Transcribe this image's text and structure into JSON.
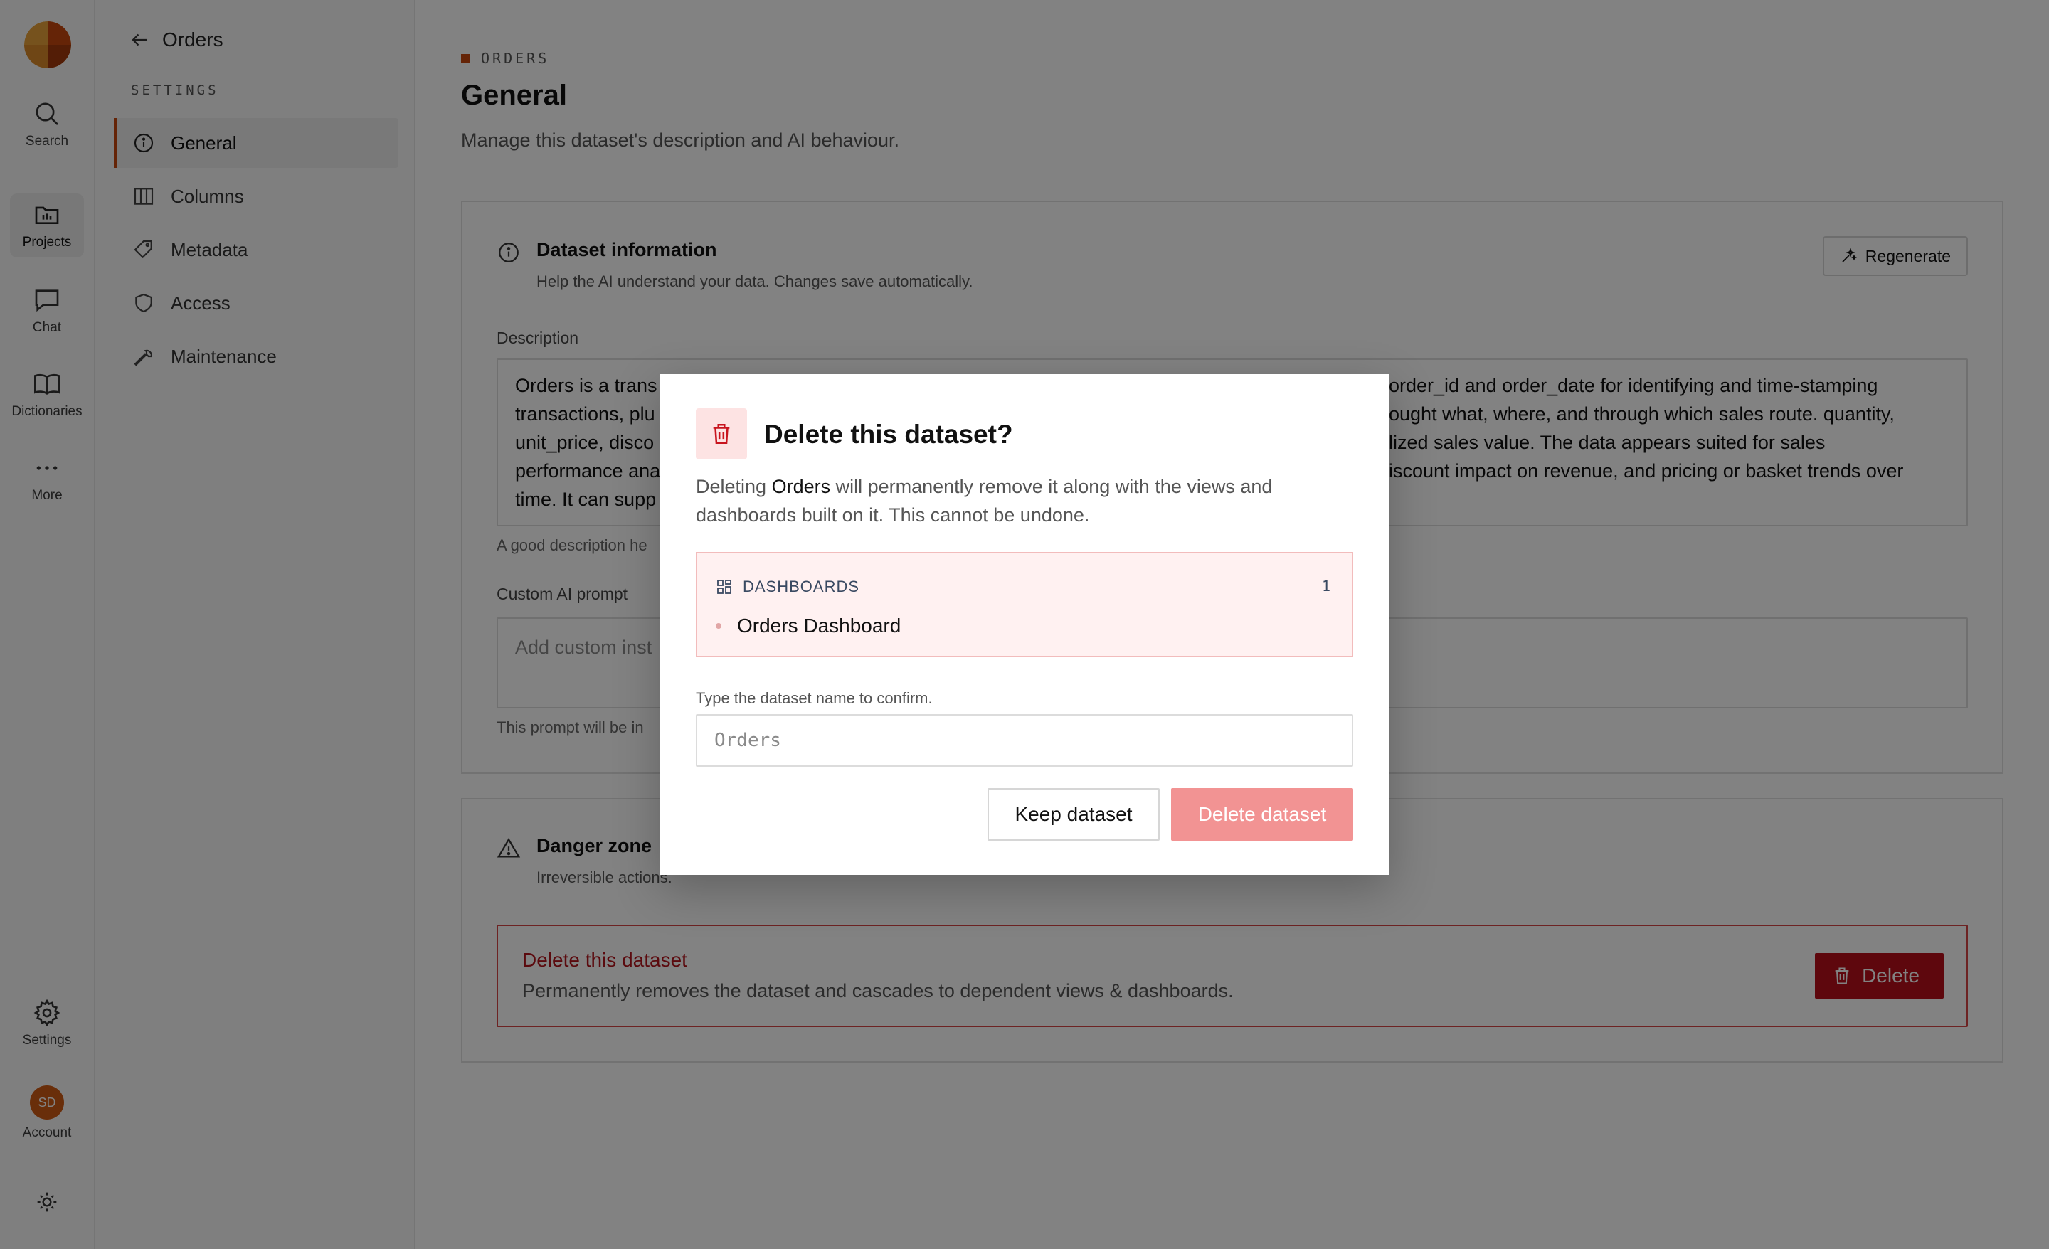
{
  "rail": {
    "items": [
      {
        "label": "Search",
        "icon": "search-icon"
      },
      {
        "label": "Projects",
        "icon": "folder-icon",
        "active": true
      },
      {
        "label": "Chat",
        "icon": "chat-icon"
      },
      {
        "label": "Dictionaries",
        "icon": "book-icon"
      },
      {
        "label": "More",
        "icon": "more-icon"
      }
    ],
    "settings_label": "Settings",
    "account_label": "Account",
    "avatar_initials": "SD"
  },
  "subnav": {
    "back_label": "Orders",
    "section_heading": "SETTINGS",
    "items": [
      {
        "label": "General",
        "icon": "info-icon",
        "active": true
      },
      {
        "label": "Columns",
        "icon": "columns-icon"
      },
      {
        "label": "Metadata",
        "icon": "tag-icon"
      },
      {
        "label": "Access",
        "icon": "shield-icon"
      },
      {
        "label": "Maintenance",
        "icon": "wrench-icon"
      }
    ]
  },
  "page": {
    "breadcrumb": "ORDERS",
    "title": "General",
    "subtitle": "Manage this dataset's description and AI behaviour."
  },
  "dataset_info": {
    "title": "Dataset information",
    "description": "Help the AI understand your data. Changes save automatically.",
    "regenerate_label": "Regenerate",
    "description_label": "Description",
    "description_left": "Orders is a trans\ntransactions, plu\nunit_price, disco\nperformance ana\ntime. It can supp",
    "description_right": "order_id and order_date for identifying and time-stamping\nought what, where, and through which sales route. quantity,\nlized sales value. The data appears suited for sales\niscount impact on revenue, and pricing or basket trends over",
    "description_hint": "A good description he",
    "prompt_label": "Custom AI prompt",
    "prompt_placeholder": "Add custom inst",
    "prompt_hint": "This prompt will be in"
  },
  "danger_zone": {
    "title": "Danger zone",
    "description": "Irreversible actions.",
    "box_title": "Delete this dataset",
    "box_description": "Permanently removes the dataset and cascades to dependent views & dashboards.",
    "delete_label": "Delete"
  },
  "modal": {
    "title": "Delete this dataset?",
    "body_prefix": "Deleting ",
    "body_name": "Orders",
    "body_suffix": " will permanently remove it along with the views and dashboards built on it. This cannot be undone.",
    "affected_heading": "DASHBOARDS",
    "affected_count": "1",
    "affected_items": [
      "Orders Dashboard"
    ],
    "confirm_label": "Type the dataset name to confirm.",
    "confirm_placeholder": "Orders",
    "keep_label": "Keep dataset",
    "delete_label": "Delete dataset"
  },
  "colors": {
    "accent": "#c7470e",
    "danger": "#b80f1a",
    "danger_disabled": "#f29393",
    "affected_bg": "#fff1f1"
  }
}
